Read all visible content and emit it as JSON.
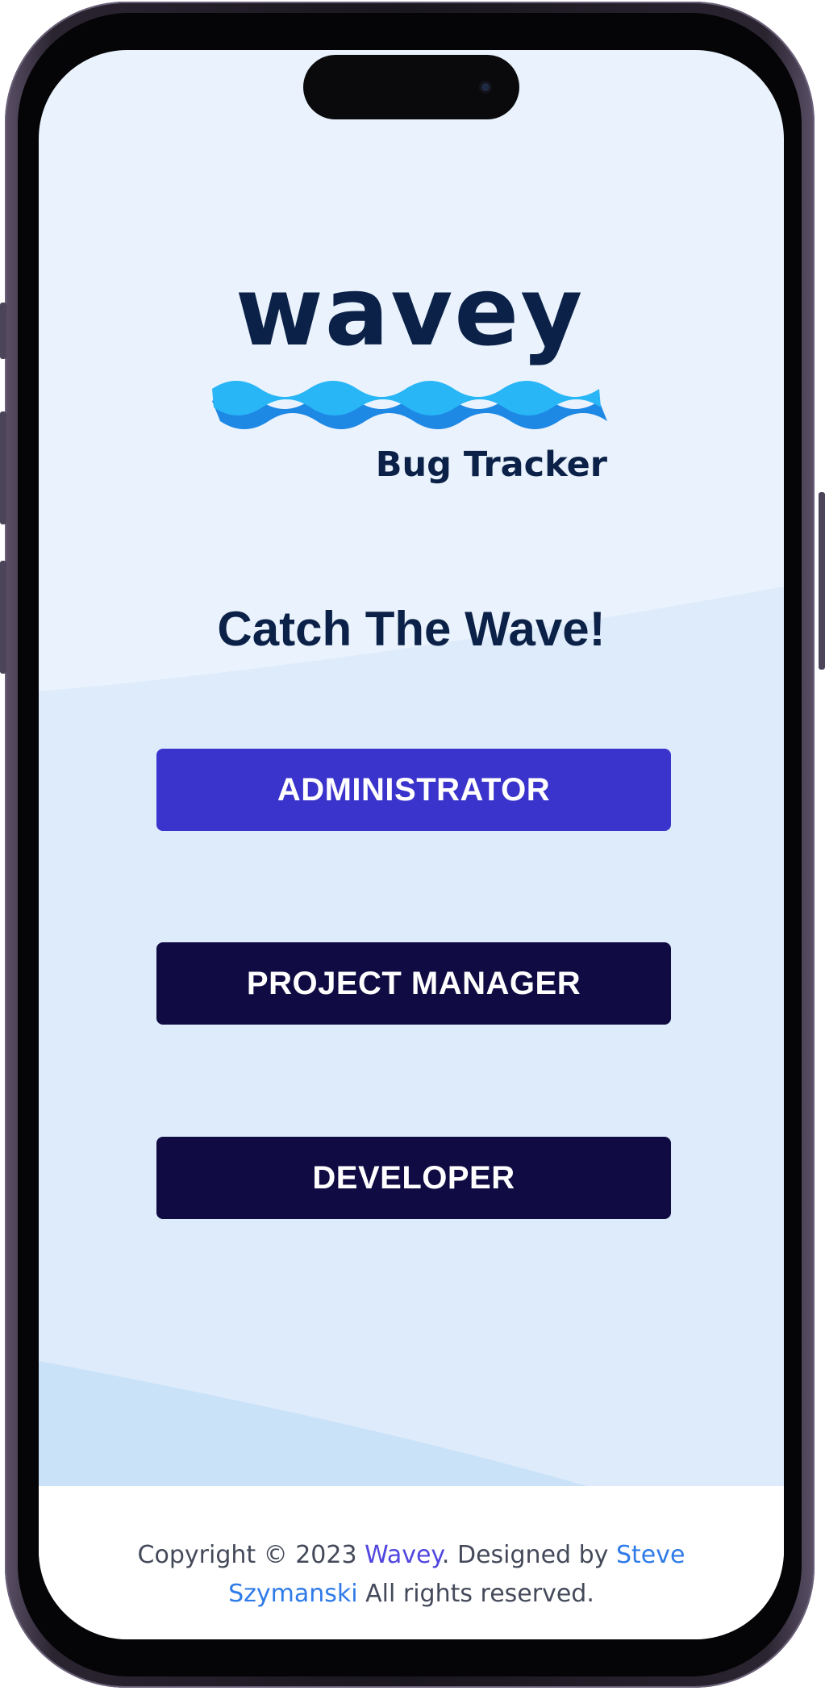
{
  "logo": {
    "wordmark": "wavey",
    "subtitle": "Bug Tracker"
  },
  "headline": "Catch The Wave!",
  "roles": {
    "administrator": "ADMINISTRATOR",
    "project_manager": "PROJECT MANAGER",
    "developer": "DEVELOPER"
  },
  "footer": {
    "prefix": "Copyright © 2023 ",
    "brand_link": "Wavey",
    "middle": ". Designed by ",
    "author_link_line1": "Steve",
    "author_link_line2": "Szymanski",
    "suffix": " All rights reserved."
  },
  "colors": {
    "brand_navy": "#0b2147",
    "admin_button": "#3a33cc",
    "dark_button": "#100b42",
    "screen_bg": "#eaf3fd",
    "wave_light": "#29b6f6",
    "wave_dark": "#1e88e5",
    "link_purple": "#5046e0",
    "link_blue": "#2f7be8"
  }
}
